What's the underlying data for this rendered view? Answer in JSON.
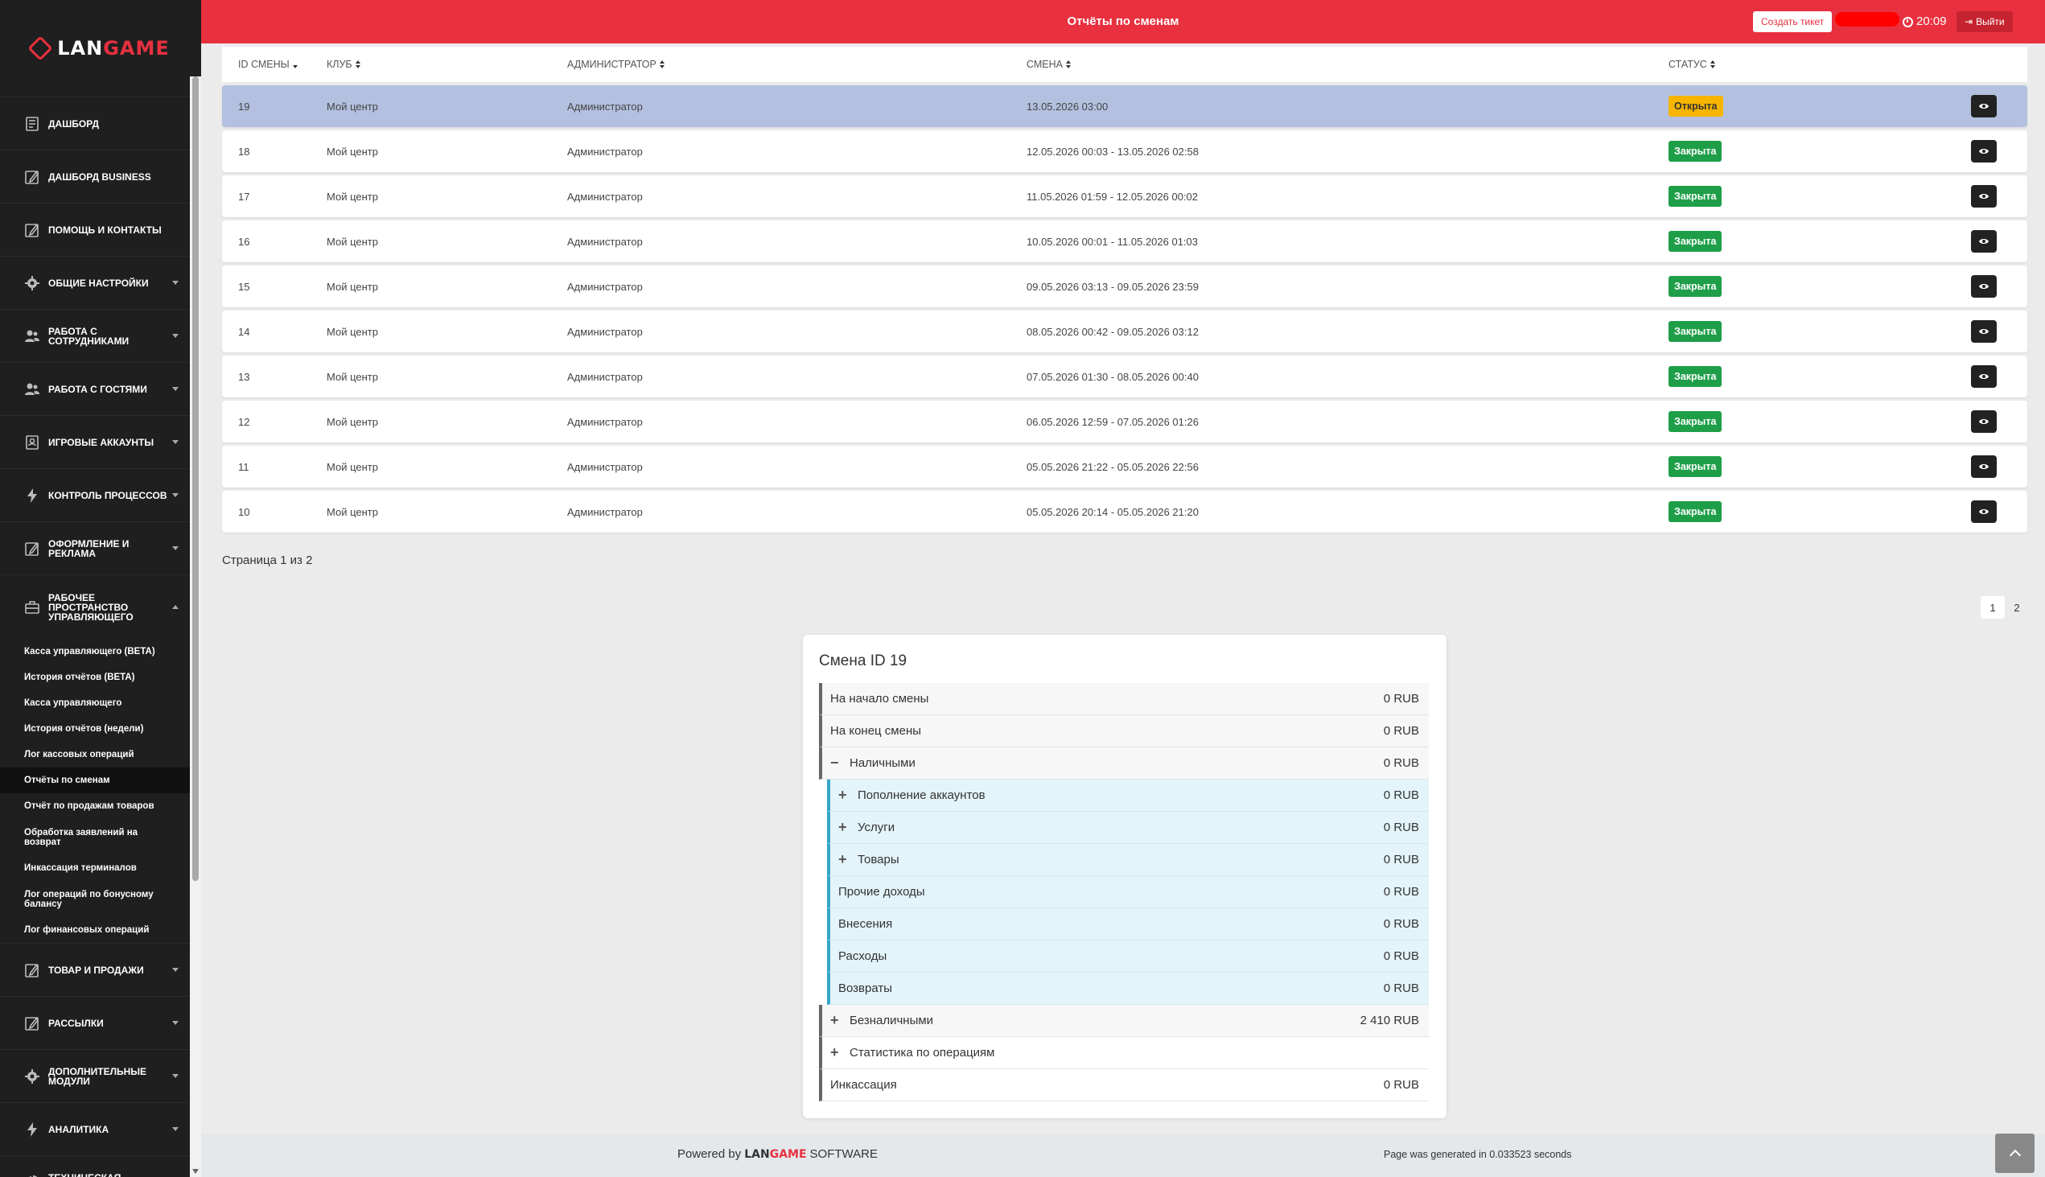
{
  "brand": {
    "logo_part1": "LAN",
    "logo_part2": "GAME"
  },
  "header": {
    "title": "Отчёты по сменам",
    "ticket_button": "Создать тикет",
    "time": "20:09",
    "exit_button": "Выйти"
  },
  "sidebar": {
    "items": [
      {
        "label": "Дашборд",
        "icon": "document-icon"
      },
      {
        "label": "Дашборд Business",
        "icon": "edit-icon"
      },
      {
        "label": "Помощь и контакты",
        "icon": "edit-icon"
      },
      {
        "label": "Общие настройки",
        "icon": "gear-icon"
      },
      {
        "label": "Работа с сотрудниками",
        "icon": "users-icon"
      },
      {
        "label": "Работа с гостями",
        "icon": "users-icon"
      },
      {
        "label": "Игровые аккаунты",
        "icon": "account-icon"
      },
      {
        "label": "Контроль процессов",
        "icon": "bolt-icon"
      },
      {
        "label": "Оформление и реклама",
        "icon": "edit-icon"
      },
      {
        "label": "Рабочее пространство управляющего",
        "icon": "briefcase-icon"
      },
      {
        "label": "Товар и продажи",
        "icon": "edit-icon"
      },
      {
        "label": "Рассылки",
        "icon": "edit-icon"
      },
      {
        "label": "Дополнительные модули",
        "icon": "gear-icon"
      },
      {
        "label": "Аналитика",
        "icon": "bolt-icon"
      },
      {
        "label": "Техническая статистика домена",
        "icon": "pie-icon"
      }
    ],
    "subitems": [
      "Касса управляющего (BETA)",
      "История отчётов (BETA)",
      "Касса управляющего",
      "История отчётов (недели)",
      "Лог кассовых операций",
      "Отчёты по сменам",
      "Отчёт по продажам товаров",
      "Обработка заявлений на возврат",
      "Инкассация терминалов",
      "Лог операций по бонусному балансу",
      "Лог финансовых операций"
    ]
  },
  "table": {
    "headers": [
      "ID смены",
      "Клуб",
      "Администратор",
      "Смена",
      "Статус"
    ],
    "rows": [
      {
        "id": "19",
        "club": "Мой центр",
        "admin": "Администратор",
        "shift": "13.05.2026 03:00",
        "status": "Открыта"
      },
      {
        "id": "18",
        "club": "Мой центр",
        "admin": "Администратор",
        "shift": "12.05.2026 00:03 - 13.05.2026 02:58",
        "status": "Закрыта"
      },
      {
        "id": "17",
        "club": "Мой центр",
        "admin": "Администратор",
        "shift": "11.05.2026 01:59 - 12.05.2026 00:02",
        "status": "Закрыта"
      },
      {
        "id": "16",
        "club": "Мой центр",
        "admin": "Администратор",
        "shift": "10.05.2026 00:01 - 11.05.2026 01:03",
        "status": "Закрыта"
      },
      {
        "id": "15",
        "club": "Мой центр",
        "admin": "Администратор",
        "shift": "09.05.2026 03:13 - 09.05.2026 23:59",
        "status": "Закрыта"
      },
      {
        "id": "14",
        "club": "Мой центр",
        "admin": "Администратор",
        "shift": "08.05.2026 00:42 - 09.05.2026 03:12",
        "status": "Закрыта"
      },
      {
        "id": "13",
        "club": "Мой центр",
        "admin": "Администратор",
        "shift": "07.05.2026 01:30 - 08.05.2026 00:40",
        "status": "Закрыта"
      },
      {
        "id": "12",
        "club": "Мой центр",
        "admin": "Администратор",
        "shift": "06.05.2026 12:59 - 07.05.2026 01:26",
        "status": "Закрыта"
      },
      {
        "id": "11",
        "club": "Мой центр",
        "admin": "Администратор",
        "shift": "05.05.2026 21:22 - 05.05.2026 22:56",
        "status": "Закрыта"
      },
      {
        "id": "10",
        "club": "Мой центр",
        "admin": "Администратор",
        "shift": "05.05.2026 20:14 - 05.05.2026 21:20",
        "status": "Закрыта"
      }
    ]
  },
  "pagination": {
    "info": "Страница 1 из 2",
    "pages": [
      "1",
      "2"
    ],
    "current": "1"
  },
  "shift_card": {
    "title": "Смена ID 19",
    "lines": [
      {
        "label": "На начало смены",
        "value": "0 RUB",
        "level": 0,
        "toggle": ""
      },
      {
        "label": "На конец смены",
        "value": "0 RUB",
        "level": 0,
        "toggle": ""
      },
      {
        "label": "Наличными",
        "value": "0 RUB",
        "level": 0,
        "toggle": "−"
      },
      {
        "label": "Пополнение аккаунтов",
        "value": "0 RUB",
        "level": 1,
        "toggle": "+"
      },
      {
        "label": "Услуги",
        "value": "0 RUB",
        "level": 1,
        "toggle": "+"
      },
      {
        "label": "Товары",
        "value": "0 RUB",
        "level": 1,
        "toggle": "+"
      },
      {
        "label": "Прочие доходы",
        "value": "0 RUB",
        "level": 1,
        "toggle": ""
      },
      {
        "label": "Внесения",
        "value": "0 RUB",
        "level": 1,
        "toggle": ""
      },
      {
        "label": "Расходы",
        "value": "0 RUB",
        "level": 1,
        "toggle": ""
      },
      {
        "label": "Возвраты",
        "value": "0 RUB",
        "level": 1,
        "toggle": ""
      },
      {
        "label": "Безналичными",
        "value": "2 410 RUB",
        "level": 0,
        "toggle": "+"
      },
      {
        "label": "Статистика по операциям",
        "value": "",
        "level": 0,
        "toggle": "+"
      },
      {
        "label": "Инкассация",
        "value": "0 RUB",
        "level": 0,
        "toggle": ""
      }
    ]
  },
  "footer": {
    "powered_by": "Powered by",
    "brand_part1": "LAN",
    "brand_part2": "GAME",
    "software": "SOFTWARE",
    "generated": "Page was generated in 0.033523 seconds"
  },
  "colors": {
    "accent": "#e8303f",
    "open": "#f7b500",
    "closed": "#1e9e48",
    "sidebar": "#1f1f1f"
  }
}
